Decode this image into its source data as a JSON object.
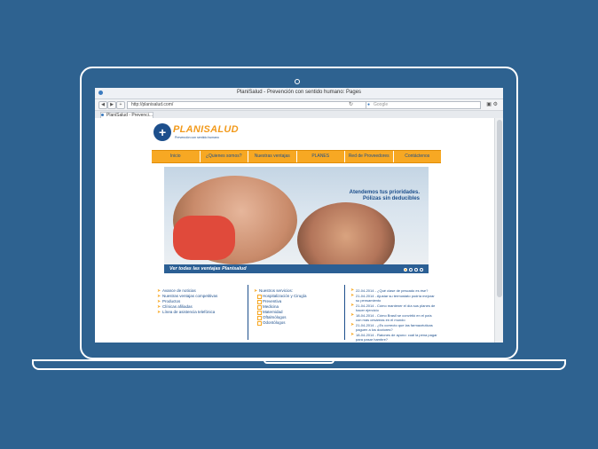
{
  "browser": {
    "window_title": "PlaniSalud - Prevención con sentido humano: Pages",
    "url": "http://planisalud.com/",
    "search_placeholder": "Google",
    "tab_label": "PlaniSalud - Prevenci..."
  },
  "site": {
    "logo_text": "PLANISALUD",
    "logo_sub": "Prevención con sentido humano"
  },
  "nav": {
    "items": [
      "Inicio",
      "¿Quienes somos?",
      "Nuestras ventajas",
      "PLANES",
      "Red de Proveedores",
      "Contáctenos"
    ]
  },
  "hero": {
    "headline_1": "Atendemos tus prioridades.",
    "headline_2": "Pólizas sin deducibles",
    "caption": "Ver todas las ventajas Planisalud"
  },
  "links": {
    "items": [
      "Avance de noticias",
      "Nuestras ventajas competitivas",
      "Productos",
      "Clínicas afiliadas",
      "Línea de asistencia telefónica"
    ]
  },
  "services": {
    "title": "Nuestros servicios:",
    "items": [
      "Hospitalización y Cirugía",
      "Preventiva",
      "Medicina",
      "Maternidad",
      "Oftalmólogos",
      "Odontólogos"
    ]
  },
  "news": {
    "items": [
      "22-04-2014 - ¿Qué clase de pescado es ése?",
      "21-04-2014 - Ajustar su termostato podría mejorar su pensamiento",
      "21-04-2014 - Cómo mantener el día sus planes de hacer ejercicio",
      "18-04-2014 - Cómo Brasil se convirtió en el país con más cesáreas en el mundo",
      "21-04-2014 - ¿Es correcto que las farmacéuticas paguen a los doctores?",
      "18-04-2014 - Ratones de ayuno: cuál la pena pagar para pasar hambre?"
    ]
  },
  "colors": {
    "background": "#2e6290",
    "accent": "#f7a823",
    "brand": "#1d4f8c"
  }
}
